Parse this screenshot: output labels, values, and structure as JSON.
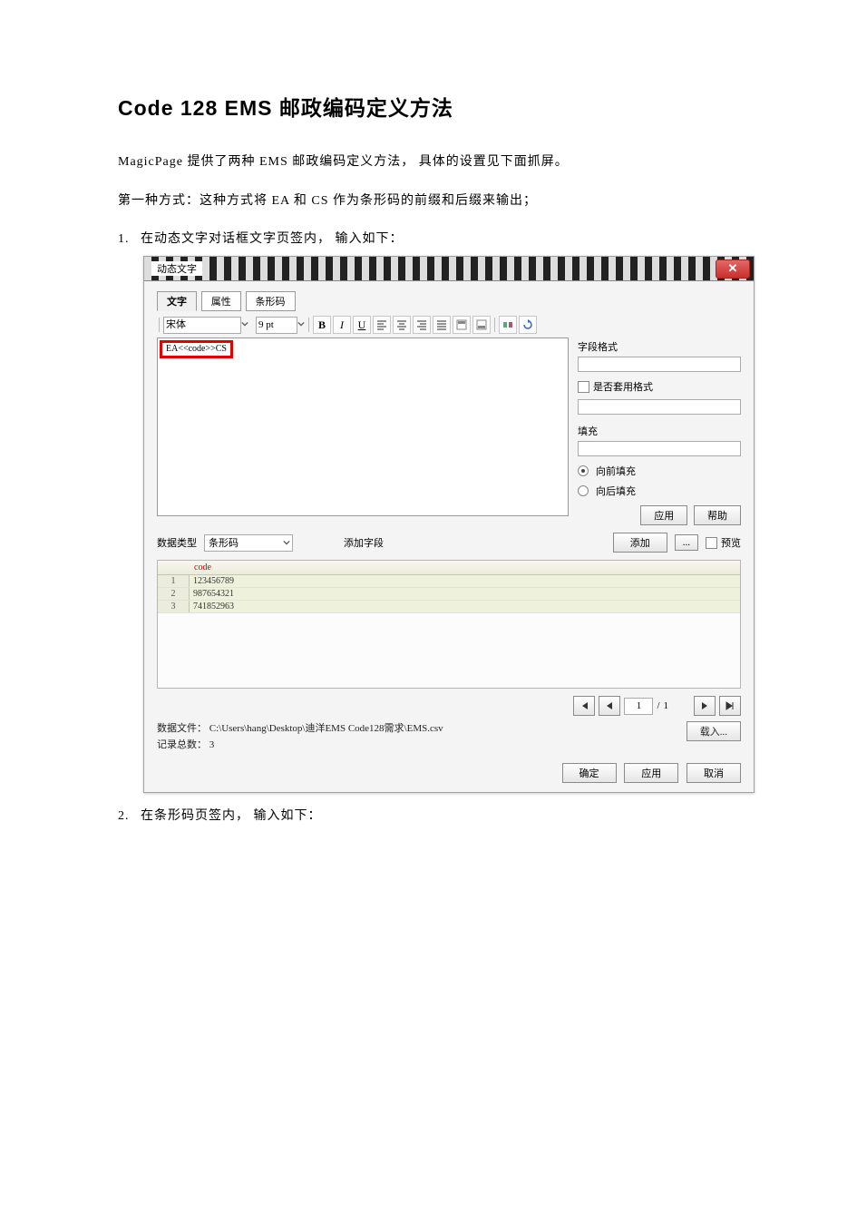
{
  "doc": {
    "title": "Code 128 EMS 邮政编码定义方法",
    "para1": "MagicPage 提供了两种 EMS 邮政编码定义方法， 具体的设置见下面抓屏。",
    "para2": "第一种方式：这种方式将 EA 和 CS 作为条形码的前缀和后缀来输出；",
    "step1_num": "1.",
    "step1_text": "在动态文字对话框文字页签内， 输入如下：",
    "step2_num": "2.",
    "step2_text": "在条形码页签内， 输入如下："
  },
  "dlg": {
    "title": "动态文字",
    "tabs": {
      "text": "文字",
      "attr": "属性",
      "barcode": "条形码"
    },
    "toolbar": {
      "font_label": "宋体",
      "size": "9 pt",
      "bold": "B",
      "italic": "I",
      "underline": "U"
    },
    "entered_code": "EA<<code>>CS",
    "right_panel": {
      "field_format_label": "字段格式",
      "use_format_label": "是否套用格式",
      "fill_label": "填充",
      "fill_front": "向前填充",
      "fill_back": "向后填充",
      "apply_btn": "应用",
      "help_btn": "帮助"
    },
    "data_row": {
      "data_type_label": "数据类型",
      "data_type_value": "条形码",
      "add_field_label": "添加字段",
      "add_btn": "添加",
      "browse_btn": "...",
      "preview_label": "预览"
    },
    "grid": {
      "header": "code",
      "rows": [
        {
          "n": "1",
          "v": "123456789"
        },
        {
          "n": "2",
          "v": "987654321"
        },
        {
          "n": "3",
          "v": "741852963"
        }
      ]
    },
    "pager": {
      "page": "1",
      "sep": "/",
      "total": "1"
    },
    "file": {
      "label": "数据文件：",
      "path": "C:\\Users\\hang\\Desktop\\迪洋EMS Code128需求\\EMS.csv",
      "records_label": "记录总数：",
      "records": "3",
      "load_btn": "载入..."
    },
    "footer": {
      "ok": "确定",
      "apply": "应用",
      "cancel": "取消"
    }
  }
}
